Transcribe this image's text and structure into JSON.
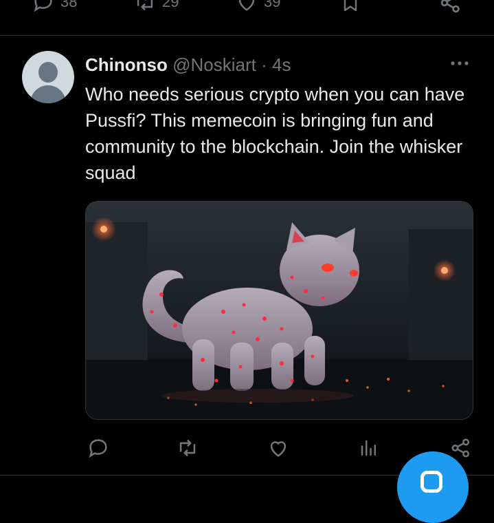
{
  "top_actions": {
    "reply_count": "38",
    "repost_count": "29",
    "like_count": "39"
  },
  "tweet": {
    "display_name": "Chinonso",
    "handle": "@Noskiart",
    "separator": "·",
    "time": "4s",
    "text": "Who needs serious crypto when you can have Pussfi? This memecoin is bringing fun and community to the blockchain. Join the whisker squad",
    "media": {
      "description_icon": "glowing-cat-image"
    }
  },
  "bottom_actions": {
    "reply_count": "",
    "repost_count": "",
    "like_count": "",
    "views_count": ""
  },
  "colors": {
    "background": "#000000",
    "text": "#e7e9ea",
    "secondary": "#71767b",
    "divider": "#2f3336",
    "accent": "#1d9bf0"
  },
  "icons": {
    "reply": "reply-icon",
    "repost": "repost-icon",
    "like": "heart-icon",
    "bookmark": "bookmark-icon",
    "share": "share-icon",
    "views": "views-icon",
    "more": "more-icon",
    "compose": "compose-icon"
  }
}
